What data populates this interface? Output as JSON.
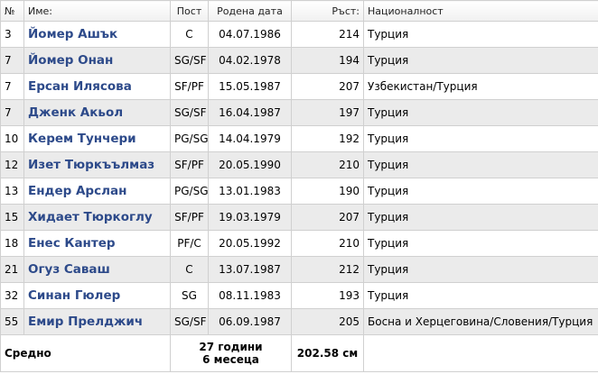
{
  "header": {
    "number": "№",
    "name": "Име:",
    "position": "Пост",
    "birthdate": "Родена дата",
    "height": "Ръст:",
    "nationality": "Националност"
  },
  "players": [
    {
      "number": "3",
      "name": "Йомер Ашък",
      "position": "C",
      "birthdate": "04.07.1986",
      "height": "214",
      "nationality": "Турция"
    },
    {
      "number": "7",
      "name": "Йомер Онан",
      "position": "SG/SF",
      "birthdate": "04.02.1978",
      "height": "194",
      "nationality": "Турция"
    },
    {
      "number": "7",
      "name": "Ерсан Илясова",
      "position": "SF/PF",
      "birthdate": "15.05.1987",
      "height": "207",
      "nationality": "Узбекистан/Турция"
    },
    {
      "number": "7",
      "name": "Дженк Акьол",
      "position": "SG/SF",
      "birthdate": "16.04.1987",
      "height": "197",
      "nationality": "Турция"
    },
    {
      "number": "10",
      "name": "Керем Тунчери",
      "position": "PG/SG",
      "birthdate": "14.04.1979",
      "height": "192",
      "nationality": "Турция"
    },
    {
      "number": "12",
      "name": "Изет Тюркъълмаз",
      "position": "SF/PF",
      "birthdate": "20.05.1990",
      "height": "210",
      "nationality": "Турция"
    },
    {
      "number": "13",
      "name": "Ендер Арслан",
      "position": "PG/SG",
      "birthdate": "13.01.1983",
      "height": "190",
      "nationality": "Турция"
    },
    {
      "number": "15",
      "name": "Хидает Тюркоглу",
      "position": "SF/PF",
      "birthdate": "19.03.1979",
      "height": "207",
      "nationality": "Турция"
    },
    {
      "number": "18",
      "name": "Енес Кантер",
      "position": "PF/C",
      "birthdate": "20.05.1992",
      "height": "210",
      "nationality": "Турция"
    },
    {
      "number": "21",
      "name": "Огуз Саваш",
      "position": "C",
      "birthdate": "13.07.1987",
      "height": "212",
      "nationality": "Турция"
    },
    {
      "number": "32",
      "name": "Синан Гюлер",
      "position": "SG",
      "birthdate": "08.11.1983",
      "height": "193",
      "nationality": "Турция"
    },
    {
      "number": "55",
      "name": "Емир Прелджич",
      "position": "SG/SF",
      "birthdate": "06.09.1987",
      "height": "205",
      "nationality": "Босна и Херцеговина/Словения/Турция"
    }
  ],
  "footer": {
    "label": "Средно",
    "avg_age_line1": "27 години",
    "avg_age_line2": "6 месеца",
    "avg_height": "202.58 см"
  },
  "colors": {
    "name_text": "#2d4a8a",
    "row_alt": "#ebebeb",
    "border": "#d0d0d0"
  }
}
